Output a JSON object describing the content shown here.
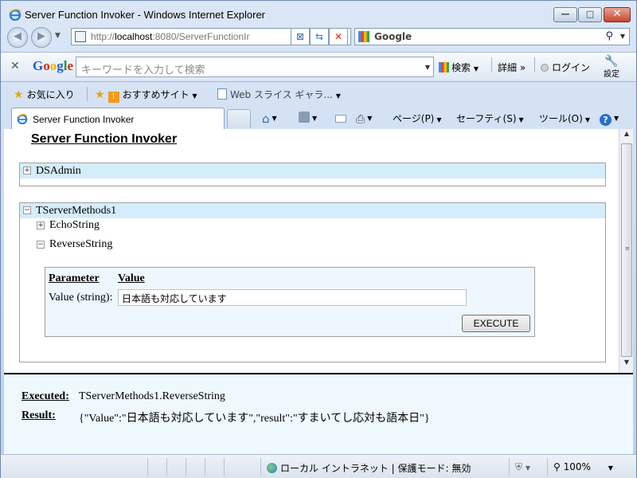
{
  "window": {
    "title": "Server Function Invoker - Windows Internet Explorer",
    "minimize": "—",
    "maximize": "□",
    "close": "✕"
  },
  "nav": {
    "url_prefix": "http://",
    "url_host": "localhost",
    "url_rest": ":8080/ServerFunctionIr",
    "search_provider": "Google"
  },
  "google_toolbar": {
    "logo": "Google",
    "search_placeholder": "キーワードを入力して検索",
    "search_button": "検索",
    "detail": "詳細 »",
    "login": "ログイン",
    "settings": "設定"
  },
  "favorites": {
    "favorites_label": "お気に入り",
    "suggested_sites": "おすすめサイト",
    "web_slice": "Web スライス ギャラ..."
  },
  "tabs": {
    "active_tab": "Server Function Invoker"
  },
  "commands": {
    "page": "ページ(P)",
    "safety": "セーフティ(S)",
    "tools": "ツール(O)"
  },
  "page": {
    "title": "Server Function Invoker",
    "classes": [
      {
        "name": "DSAdmin",
        "expanded": false
      },
      {
        "name": "TServerMethods1",
        "expanded": true,
        "methods": [
          {
            "name": "EchoString",
            "expanded": false
          },
          {
            "name": "ReverseString",
            "expanded": true
          }
        ]
      }
    ],
    "params": {
      "header_parameter": "Parameter",
      "header_value": "Value",
      "label": "Value (string):",
      "value": "日本語も対応しています",
      "execute": "EXECUTE"
    }
  },
  "result": {
    "executed_label": "Executed:",
    "executed_value": "TServerMethods1.ReverseString",
    "result_label": "Result:",
    "result_value": "{\"Value\":\"日本語も対応しています\",\"result\":\"すまいてし応対も語本日\"}"
  },
  "status": {
    "zone": "ローカル イントラネット | 保護モード: 無効",
    "zoom": "100%"
  },
  "colors": {
    "panel_header": "#d4edfb",
    "param_box": "#eef7fd",
    "result_bg": "#eef8fd"
  }
}
